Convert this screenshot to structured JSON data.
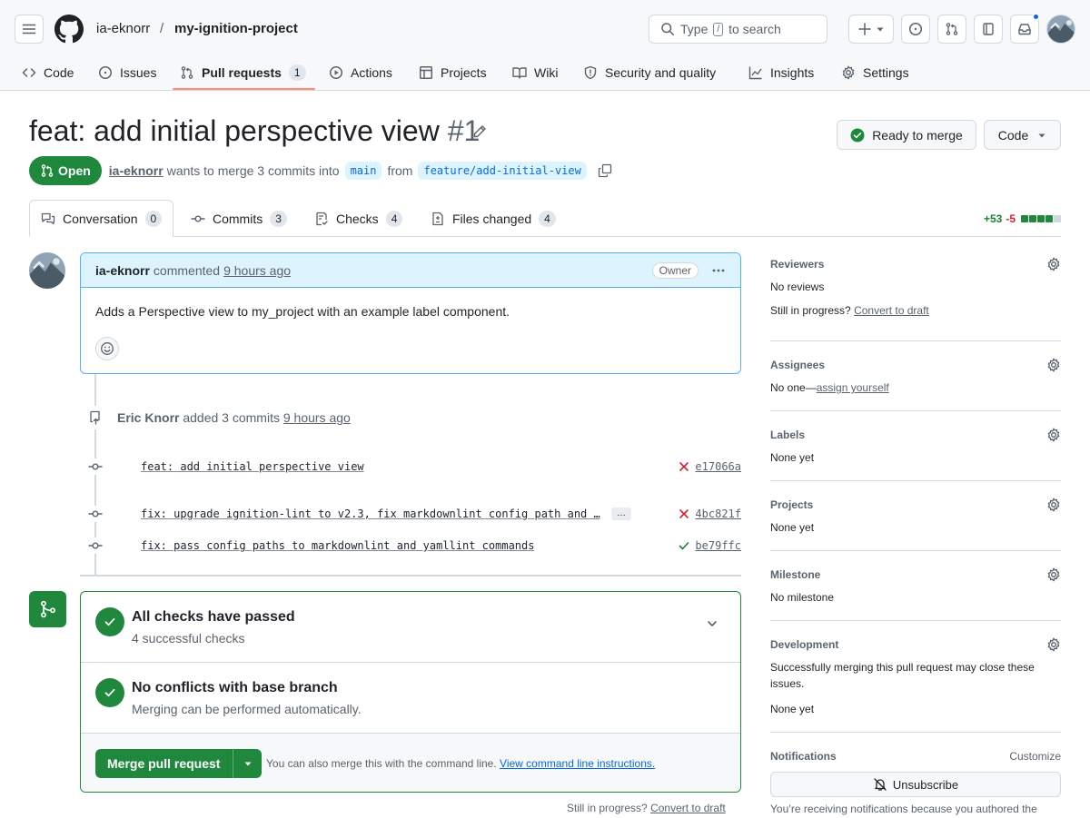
{
  "header": {
    "owner": "ia-eknorr",
    "separator": "/",
    "repo": "my-ignition-project",
    "search_prefix": "Type",
    "search_key": "/",
    "search_suffix": "to search"
  },
  "repo_nav": [
    {
      "label": "Code",
      "icon": "code-icon"
    },
    {
      "label": "Issues",
      "icon": "issue-opened-icon"
    },
    {
      "label": "Pull requests",
      "icon": "git-pull-request-icon",
      "count": "1",
      "active": true
    },
    {
      "label": "Actions",
      "icon": "play-icon"
    },
    {
      "label": "Projects",
      "icon": "table-icon"
    },
    {
      "label": "Wiki",
      "icon": "book-icon"
    },
    {
      "label": "Security and quality",
      "icon": "shield-icon"
    },
    {
      "label": "Insights",
      "icon": "graph-icon"
    },
    {
      "label": "Settings",
      "icon": "gear-icon"
    }
  ],
  "pr": {
    "title": "feat: add initial perspective view",
    "number": "#1",
    "ready_label": "Ready to merge",
    "code_label": "Code",
    "state": "Open",
    "author": "ia-eknorr",
    "meta_text": "wants to merge 3 commits into",
    "base_branch": "main",
    "from_text": "from",
    "head_branch": "feature/add-initial-view"
  },
  "tabs": [
    {
      "label": "Conversation",
      "count": "0",
      "icon": "comment-discussion-icon",
      "active": true
    },
    {
      "label": "Commits",
      "count": "3",
      "icon": "git-commit-icon"
    },
    {
      "label": "Checks",
      "count": "4",
      "icon": "checklist-icon"
    },
    {
      "label": "Files changed",
      "count": "4",
      "icon": "file-diff-icon"
    }
  ],
  "diffstat": {
    "additions": "+53",
    "deletions": "-5",
    "boxes": [
      "#1f883d",
      "#1f883d",
      "#1f883d",
      "#1f883d",
      "#d1d9e0"
    ]
  },
  "comment": {
    "author": "ia-eknorr",
    "action": "commented",
    "time": "9 hours ago",
    "badge": "Owner",
    "body": "Adds a Perspective view to my_project with an example label component."
  },
  "commit_event": {
    "who": "Eric Knorr",
    "action": "added 3 commits",
    "time": "9 hours ago"
  },
  "commits": [
    {
      "message": "feat: add initial perspective view",
      "status": "fail",
      "sha": "e17066a",
      "has_more": false
    },
    {
      "message": "fix: upgrade ignition-lint to v2.3, fix markdownlint config path and …",
      "status": "fail",
      "sha": "4bc821f",
      "has_more": true,
      "more_label": "…"
    },
    {
      "message": "fix: pass config paths to markdownlint and yamllint commands",
      "status": "success",
      "sha": "be79ffc",
      "has_more": false
    }
  ],
  "merge": {
    "checks_title": "All checks have passed",
    "checks_sub": "4 successful checks",
    "conflicts_title": "No conflicts with base branch",
    "conflicts_sub": "Merging can be performed automatically.",
    "merge_label": "Merge pull request",
    "hint_text": "You can also merge this with the command line.",
    "hint_link": "View command line instructions.",
    "draft_prefix": "Still in progress?",
    "draft_link": "Convert to draft"
  },
  "sidebar": {
    "reviewers": {
      "title": "Reviewers",
      "line1": "No reviews",
      "line2_prefix": "Still in progress?",
      "line2_link": "Convert to draft"
    },
    "assignees": {
      "title": "Assignees",
      "prefix": "No one—",
      "link": "assign yourself"
    },
    "labels": {
      "title": "Labels",
      "value": "None yet"
    },
    "projects": {
      "title": "Projects",
      "value": "None yet"
    },
    "milestone": {
      "title": "Milestone",
      "value": "No milestone"
    },
    "development": {
      "title": "Development",
      "desc": "Successfully merging this pull request may close these issues.",
      "value": "None yet"
    },
    "notifications": {
      "title": "Notifications",
      "customize": "Customize",
      "button": "Unsubscribe",
      "reason": "You’re receiving notifications because you authored the"
    }
  },
  "colors": {
    "accent": "#0969da",
    "success": "#1f883d",
    "danger": "#d1242f",
    "nav_underline": "#fd8c73"
  }
}
